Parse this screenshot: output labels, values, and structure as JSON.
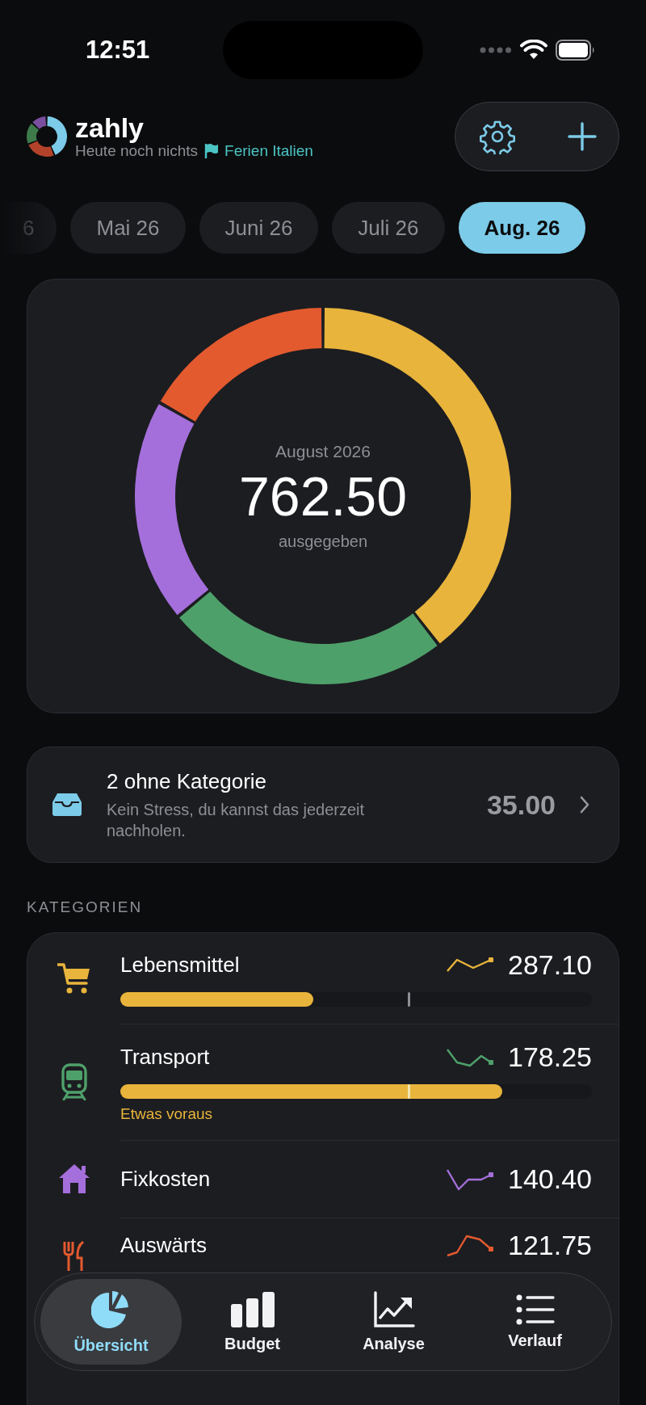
{
  "status_bar": {
    "time": "12:51"
  },
  "header": {
    "app_name": "zahly",
    "subtitle": "Heute noch nichts",
    "trip": {
      "label": "Ferien Italien"
    }
  },
  "months": [
    {
      "label": "6",
      "selected": false
    },
    {
      "label": "Mai 26",
      "selected": false
    },
    {
      "label": "Juni 26",
      "selected": false
    },
    {
      "label": "Juli 26",
      "selected": false
    },
    {
      "label": "Aug. 26",
      "selected": true
    }
  ],
  "summary": {
    "period": "August 2026",
    "total": "762.50",
    "caption": "ausgegeben"
  },
  "uncategorized": {
    "title": "2 ohne Kategorie",
    "message": "Kein Stress, du kannst das jederzeit nachholen.",
    "amount": "35.00"
  },
  "categories_heading": "KATEGORIEN",
  "categories": [
    {
      "name": "Lebensmittel",
      "amount": "287.10",
      "color": "#e8b43c",
      "kind": "cart",
      "bar": {
        "level": 0.41,
        "color": "#e8b43c",
        "pace": {
          "level": 0.61
        }
      }
    },
    {
      "name": "Transport",
      "amount": "178.25",
      "color": "#4ea06a",
      "kind": "train",
      "bar": {
        "level": 0.81,
        "color": "#e8b43c",
        "pace": {
          "level": 0.61
        }
      },
      "note": "Etwas voraus"
    },
    {
      "name": "Fixkosten",
      "amount": "140.40",
      "color": "#a46fdb",
      "kind": "house"
    },
    {
      "name": "Auswärts",
      "amount": "121.75",
      "color": "#e35a2f",
      "kind": "dining"
    }
  ],
  "tabs": [
    {
      "label": "Übersicht",
      "kind": "pie",
      "selected": true
    },
    {
      "label": "Budget",
      "kind": "bars",
      "selected": false
    },
    {
      "label": "Analyse",
      "kind": "chart",
      "selected": false
    },
    {
      "label": "Verlauf",
      "kind": "list",
      "selected": false
    }
  ]
}
